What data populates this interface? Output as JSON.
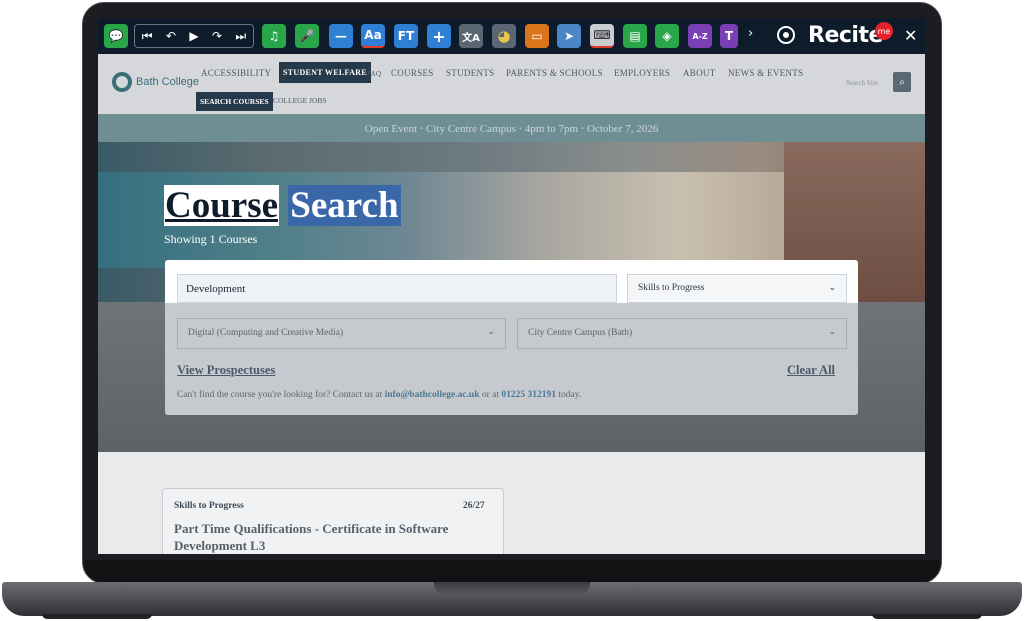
{
  "toolbar": {
    "brand": "Recite",
    "badge": "me",
    "buttons": [
      {
        "name": "chat-icon",
        "glyph": "💬"
      },
      {
        "name": "skip-back-icon",
        "glyph": "⏮"
      },
      {
        "name": "rewind-icon",
        "glyph": "↶"
      },
      {
        "name": "play-icon",
        "glyph": "▶"
      },
      {
        "name": "forward-icon",
        "glyph": "↷"
      },
      {
        "name": "skip-forward-icon",
        "glyph": "⏭"
      },
      {
        "name": "music-icon",
        "glyph": "♫"
      },
      {
        "name": "mic-icon",
        "glyph": "🎤"
      },
      {
        "name": "minus-icon",
        "glyph": "—"
      },
      {
        "name": "font-size-icon",
        "glyph": "Aa"
      },
      {
        "name": "font-type-icon",
        "glyph": "FT"
      },
      {
        "name": "plus-icon",
        "glyph": "+"
      },
      {
        "name": "translate-icon",
        "glyph": "文A"
      },
      {
        "name": "color-wheel-icon",
        "glyph": "◕"
      },
      {
        "name": "ruler-icon",
        "glyph": "▭"
      },
      {
        "name": "cursor-icon",
        "glyph": "➤"
      },
      {
        "name": "keyboard-icon",
        "glyph": "⌨"
      },
      {
        "name": "page-icon",
        "glyph": "▤"
      },
      {
        "name": "layers-icon",
        "glyph": "◈"
      },
      {
        "name": "dictionary-icon",
        "glyph": "A-Z"
      },
      {
        "name": "text-mode-icon",
        "glyph": "T"
      }
    ],
    "more": "›",
    "close": "✕"
  },
  "nav": {
    "logo": "Bath College",
    "items": [
      "ACCESSIBILITY",
      "STUDENT WELFARE",
      "FAQ",
      "COURSES",
      "STUDENTS",
      "PARENTS & SCHOOLS",
      "EMPLOYERS",
      "ABOUT",
      "NEWS & EVENTS"
    ],
    "sub_items": [
      "SEARCH COURSES",
      "COLLEGE JOBS"
    ],
    "search_placeholder": "Search Site",
    "search_glyph": "⌕"
  },
  "banner": {
    "text": "Open Event ⋅ City Centre Campus ⋅ 4pm to 7pm ⋅ October 7, 2026"
  },
  "hero": {
    "title_word1": "Course",
    "title_word2": "Search",
    "subtitle": "Showing 1 Courses"
  },
  "search": {
    "keyword_value": "Development",
    "level_value": "Skills to Progress",
    "subject_value": "Digital (Computing and Creative Media)",
    "campus_value": "City Centre Campus (Bath)",
    "view_prospectuses": "View Prospectuses",
    "clear_all": "Clear All",
    "contact_prefix": "Can't find the course you're looking for? Contact us at",
    "contact_email": "info@bathcollege.ac.uk",
    "contact_mid": "or at",
    "contact_phone": "01225 312191",
    "contact_suffix": "today."
  },
  "course_card": {
    "type": "Skills to Progress",
    "code": "26/27",
    "title": "Part Time Qualifications - Certificate in Software Development L3"
  }
}
